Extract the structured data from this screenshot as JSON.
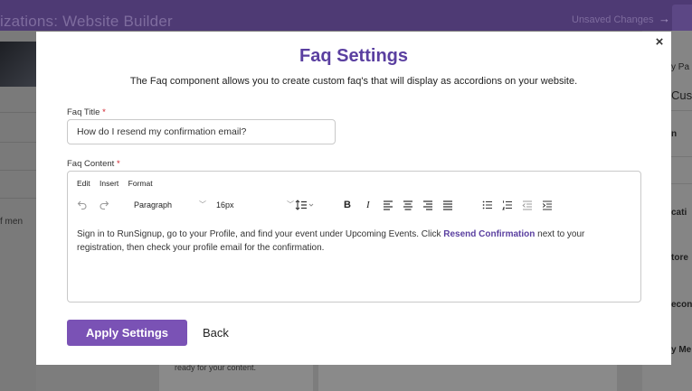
{
  "background": {
    "title": "izations: Website Builder",
    "unsaved": "Unsaved Changes",
    "arrow": "→",
    "left_label": "f men",
    "right_labels": [
      "y Pa",
      "Cust",
      "n",
      "cati",
      "tore",
      "econ",
      "y Me"
    ],
    "bottom_text": "ready for your content."
  },
  "modal": {
    "close_label": "×",
    "title": "Faq Settings",
    "description": "The Faq component allows you to create custom faq's that will display as accordions on your website.",
    "faq_title_label": "Faq Title",
    "faq_title_value": "How do I resend my confirmation email?",
    "faq_content_label": "Faq Content",
    "required_mark": "*",
    "editor": {
      "menu": [
        "Edit",
        "Insert",
        "Format"
      ],
      "block_format": "Paragraph",
      "font_size": "16px",
      "content_part1": "Sign in to RunSignup, go to your Profile, and find your event under Upcoming Events. Click ",
      "content_link": "Resend Confirmation",
      "content_part2": " next to your registration, then check your profile email for the confirmation."
    },
    "apply_label": "Apply Settings",
    "back_label": "Back"
  },
  "colors": {
    "accent": "#5a3fa0",
    "button": "#7a52b5",
    "required": "#d0202b",
    "header_bg": "#4e3a74"
  }
}
